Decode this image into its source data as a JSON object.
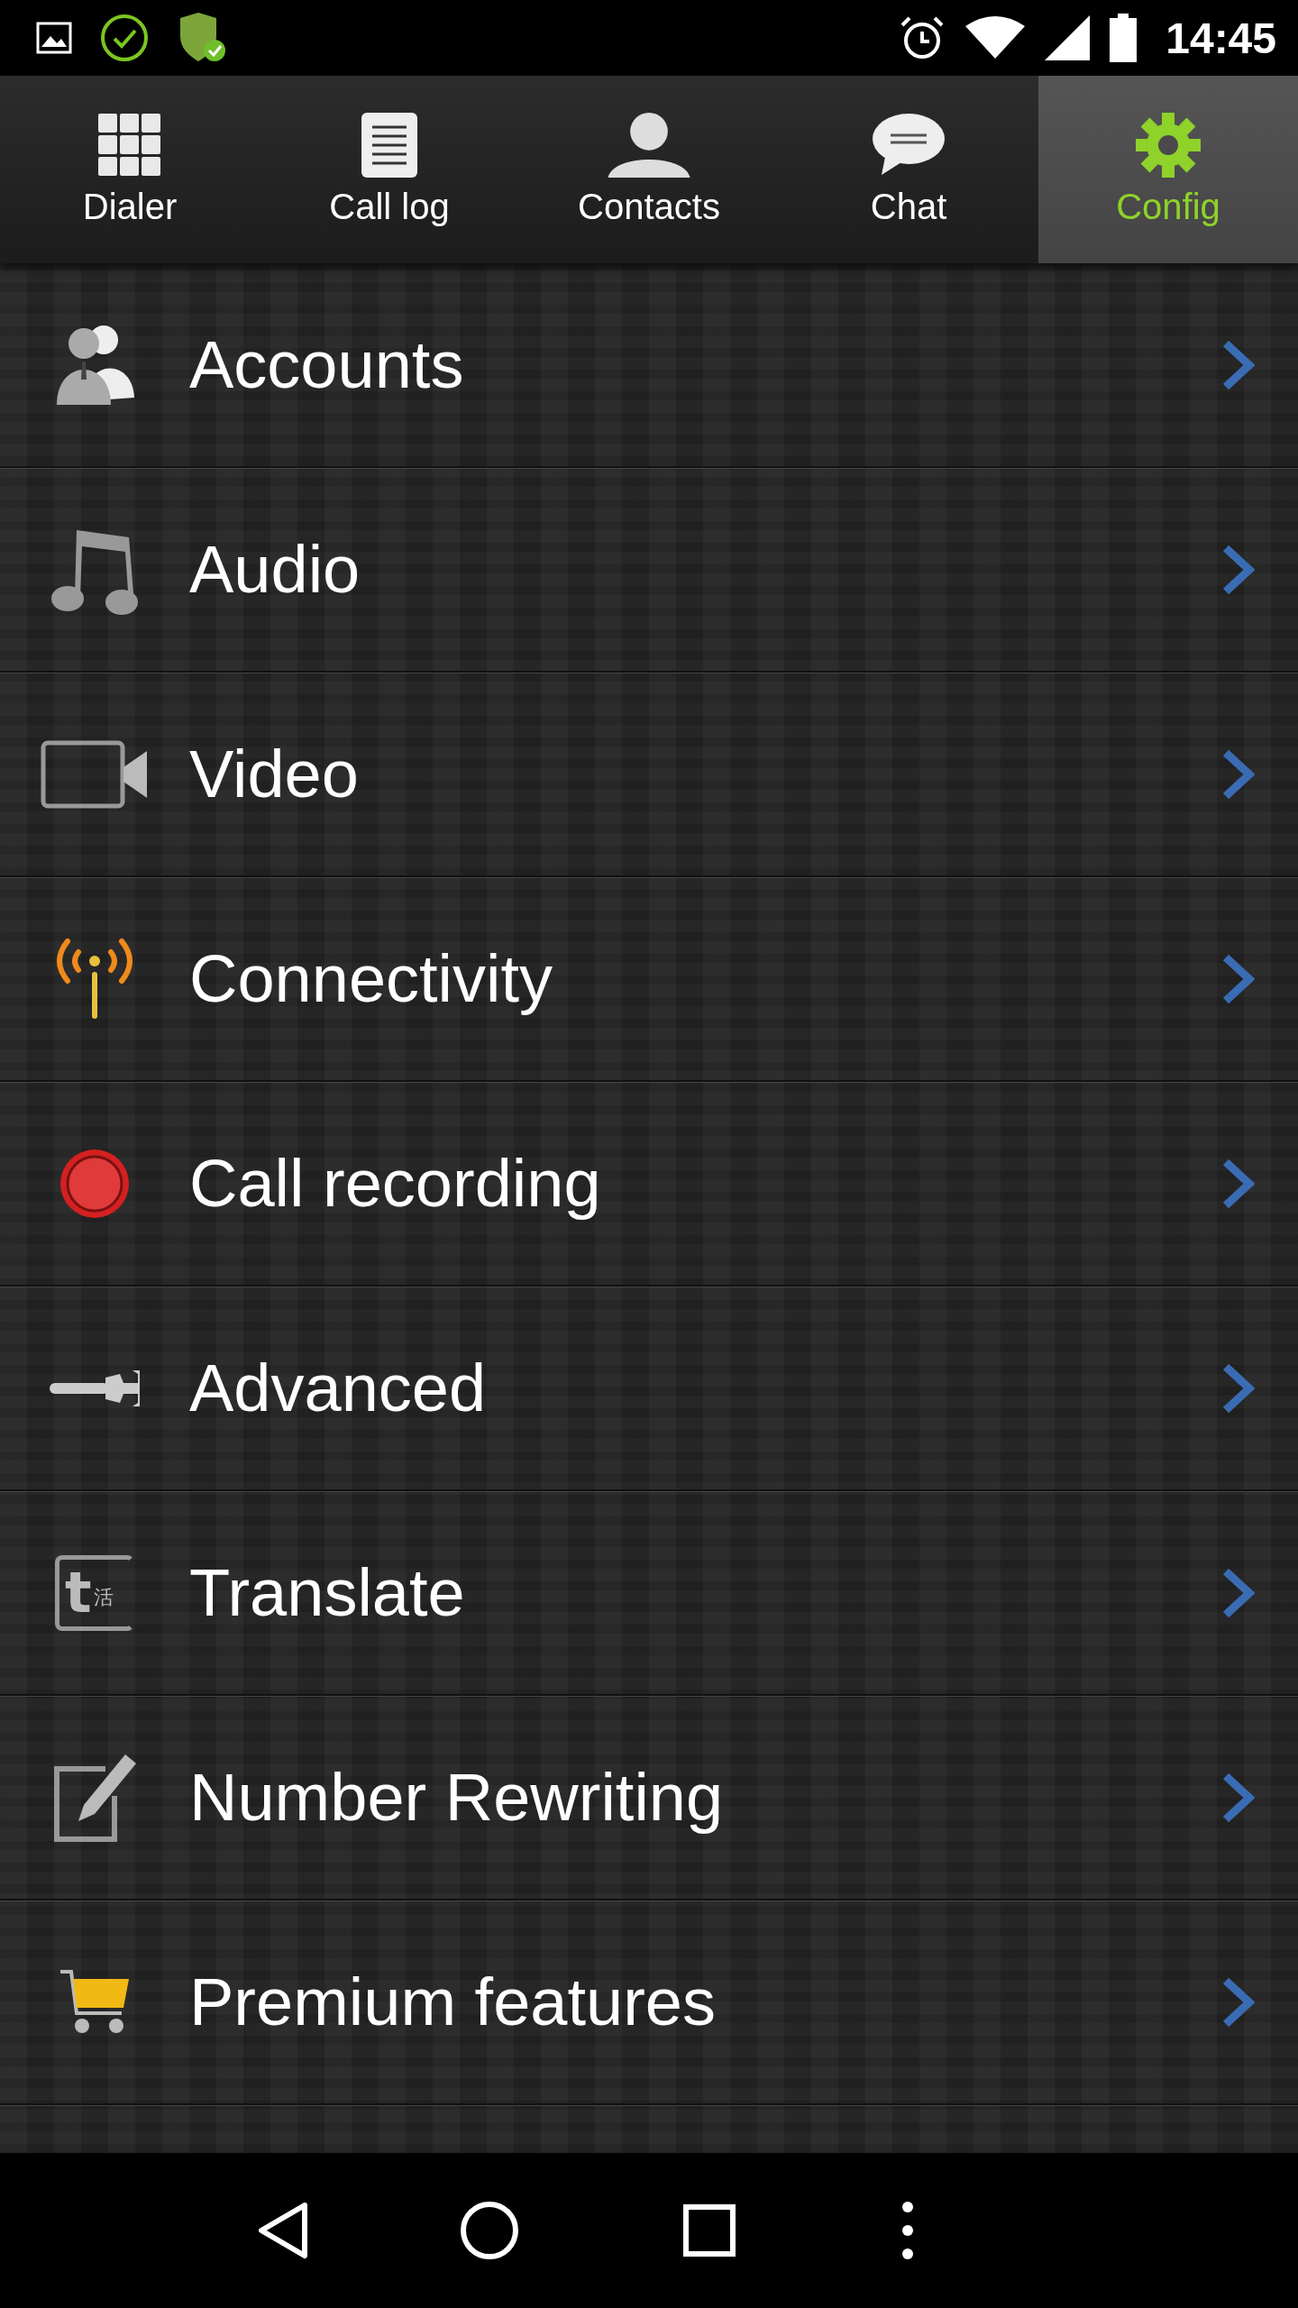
{
  "status_bar": {
    "time": "14:45"
  },
  "tabs": [
    {
      "label": "Dialer",
      "kind": "dialer",
      "selected": false
    },
    {
      "label": "Call log",
      "kind": "calllog",
      "selected": false
    },
    {
      "label": "Contacts",
      "kind": "contacts",
      "selected": false
    },
    {
      "label": "Chat",
      "kind": "chat",
      "selected": false
    },
    {
      "label": "Config",
      "kind": "config",
      "selected": true
    }
  ],
  "items": [
    {
      "label": "Accounts",
      "kind": "accounts"
    },
    {
      "label": "Audio",
      "kind": "audio"
    },
    {
      "label": "Video",
      "kind": "video"
    },
    {
      "label": "Connectivity",
      "kind": "connectivity"
    },
    {
      "label": "Call recording",
      "kind": "recording"
    },
    {
      "label": "Advanced",
      "kind": "advanced"
    },
    {
      "label": "Translate",
      "kind": "translate",
      "icon_text": [
        "t",
        "活"
      ]
    },
    {
      "label": "Number Rewriting",
      "kind": "rewriting"
    },
    {
      "label": "Premium features",
      "kind": "premium"
    }
  ]
}
